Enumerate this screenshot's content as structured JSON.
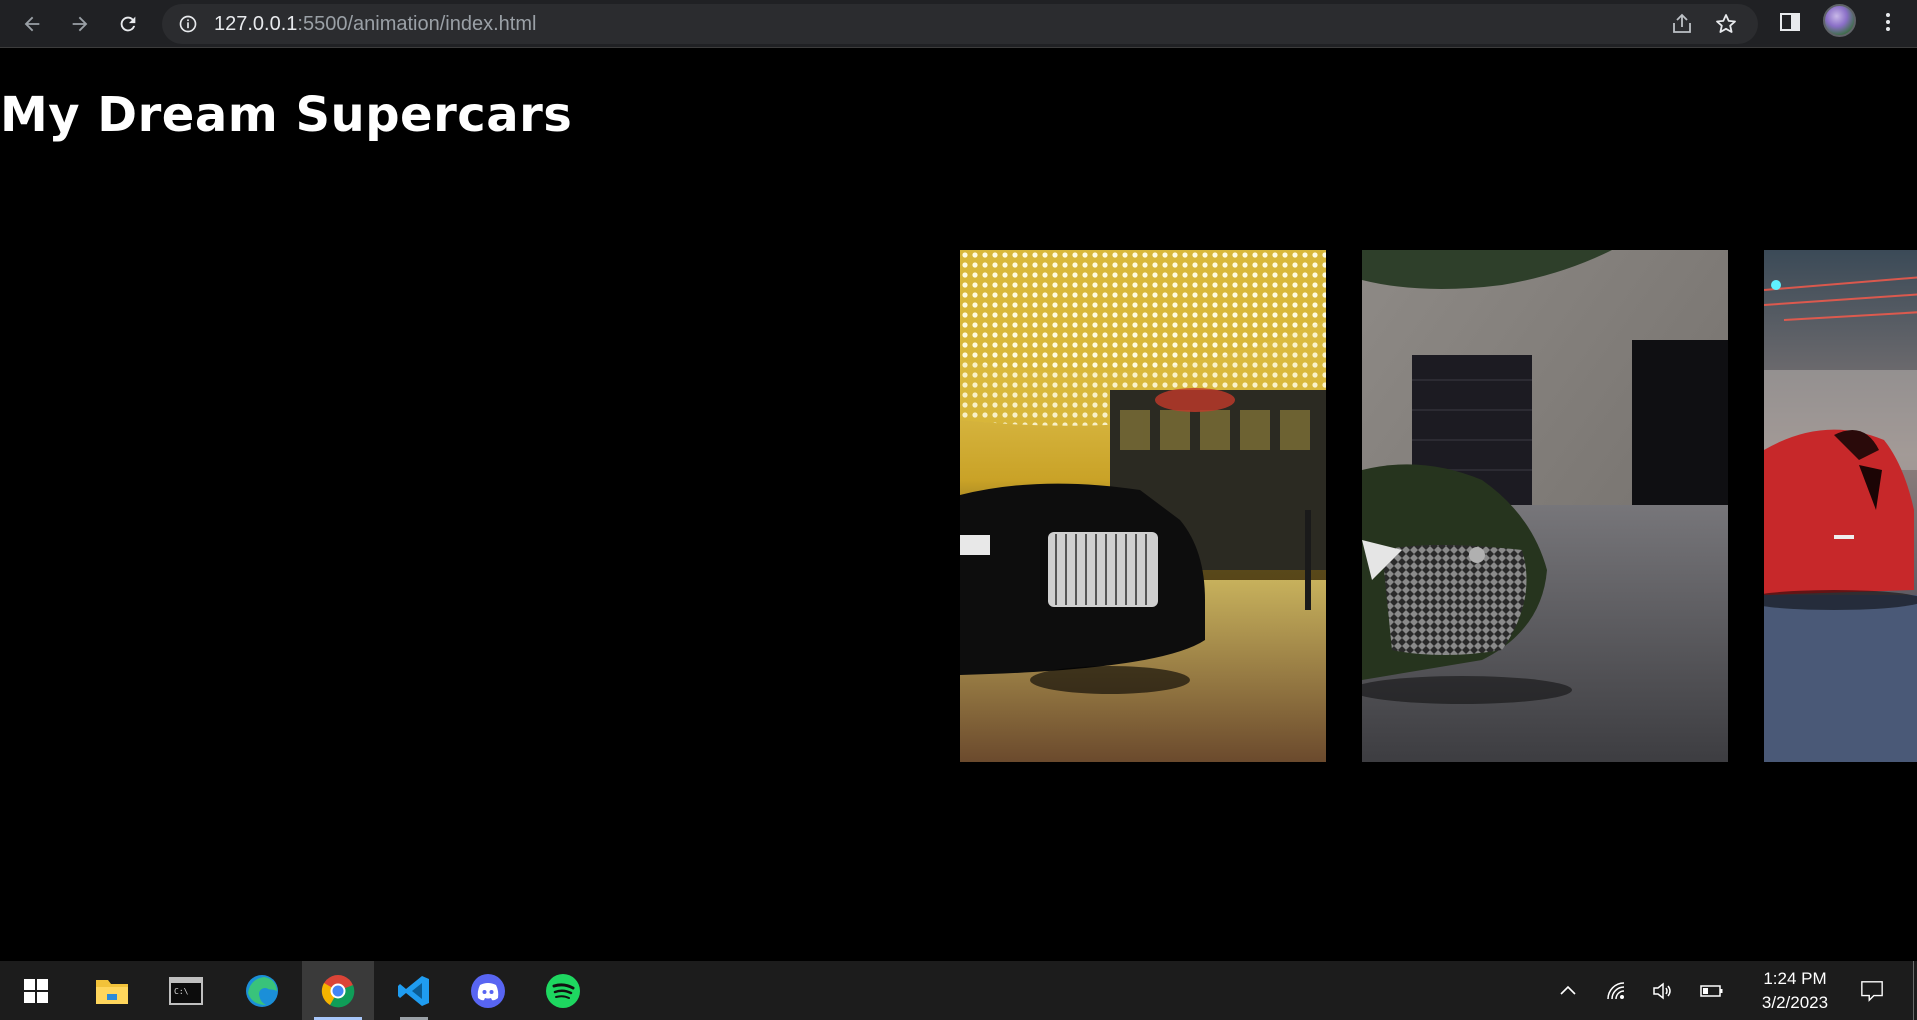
{
  "browser": {
    "url_host": "127.0.0.1",
    "url_rest": ":5500/animation/index.html",
    "back_icon": "arrow-left",
    "forward_icon": "arrow-right",
    "reload_icon": "refresh",
    "site_info_icon": "info-circle",
    "share_icon": "share",
    "bookmark_icon": "star",
    "sidepanel_icon": "side-panel",
    "menu_icon": "kebab-vertical"
  },
  "page": {
    "title": "My Dream Supercars",
    "cards": [
      {
        "name": "rolls-royce-casino",
        "scene": "black luxury sedan under golden marquee lights"
      },
      {
        "name": "lexus-garage",
        "scene": "green sports coupe in front of concrete garage"
      },
      {
        "name": "red-supercar-city",
        "scene": "red supercar on city street at night"
      }
    ]
  },
  "taskbar": {
    "apps": [
      {
        "name": "start",
        "icon": "windows-logo"
      },
      {
        "name": "file-explorer",
        "icon": "folder"
      },
      {
        "name": "terminal",
        "icon": "command-prompt"
      },
      {
        "name": "edge",
        "icon": "edge-browser"
      },
      {
        "name": "chrome",
        "icon": "chrome-browser",
        "active": true
      },
      {
        "name": "vscode",
        "icon": "vscode",
        "open": true
      },
      {
        "name": "discord",
        "icon": "discord"
      },
      {
        "name": "spotify",
        "icon": "spotify"
      }
    ],
    "time": "1:24 PM",
    "date": "3/2/2023"
  },
  "colors": {
    "page_bg": "#000000",
    "chrome_bg": "#202124",
    "taskbar_bg": "#1c1c1c"
  }
}
